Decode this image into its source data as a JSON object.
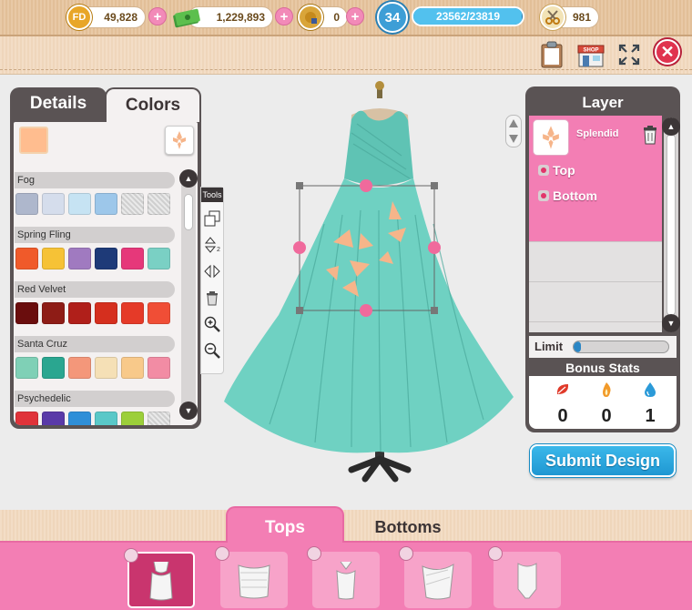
{
  "resources": {
    "fd_icon_text": "FD",
    "fd_coins": "49,828",
    "cash": "1,229,893",
    "facebook_credits": "0",
    "level": "34",
    "xp": "23562/23819",
    "xp_progress": 0.989,
    "scissors": "981"
  },
  "left_panel": {
    "tabs": [
      "Details",
      "Colors"
    ],
    "active_tab": "Colors",
    "selected_color": "#ffbd8f",
    "palettes": [
      {
        "name": "Fog",
        "colors": [
          "#aeb7cc",
          "#d5ddec",
          "#c6e3f3",
          "#9dc7ea",
          "hatch",
          "hatch"
        ]
      },
      {
        "name": "Spring Fling",
        "colors": [
          "#f05a2a",
          "#f6c236",
          "#a07ac0",
          "#1e3a78",
          "#e6387a",
          "#7ad0c4"
        ]
      },
      {
        "name": "Red Velvet",
        "colors": [
          "#6a0d0d",
          "#8e1c16",
          "#b01f1a",
          "#d52f1e",
          "#e53a28",
          "#f04e36"
        ]
      },
      {
        "name": "Santa Cruz",
        "colors": [
          "#7fd0b6",
          "#2aa690",
          "#f4977a",
          "#f5e0b6",
          "#f8c98a",
          "#f28ca4"
        ]
      },
      {
        "name": "Psychedelic",
        "colors": [
          "#e0333a",
          "#5a3aa8",
          "#2f8fd8",
          "#5ac8c8",
          "#9ccf3a",
          "hatch"
        ]
      }
    ]
  },
  "tools": {
    "label": "Tools",
    "items": [
      "duplicate",
      "flip-vertical",
      "flip-horizontal",
      "delete",
      "zoom-in",
      "zoom-out"
    ]
  },
  "layer_panel": {
    "title": "Layer",
    "active_layer": "Splendid",
    "sublayers": [
      "Top",
      "Bottom"
    ],
    "limit_label": "Limit",
    "limit_fill": 0.05,
    "bonus_title": "Bonus Stats",
    "stats": [
      {
        "icon": "red-leaf-icon",
        "value": "0"
      },
      {
        "icon": "flame-icon",
        "value": "0"
      },
      {
        "icon": "water-drop-icon",
        "value": "1"
      }
    ]
  },
  "submit_label": "Submit Design",
  "bottom": {
    "tabs": [
      "Tops",
      "Bottoms"
    ],
    "active_tab": "Tops",
    "items": [
      "camisole",
      "strapless-tube-top",
      "halter-corset",
      "draped-bustier",
      "bodysuit"
    ]
  },
  "colors": {
    "accent_pink": "#f37eb4",
    "panel_dark": "#5a5354",
    "dress_teal": "#6fd1c2",
    "submit_blue": "#2aa7de"
  }
}
